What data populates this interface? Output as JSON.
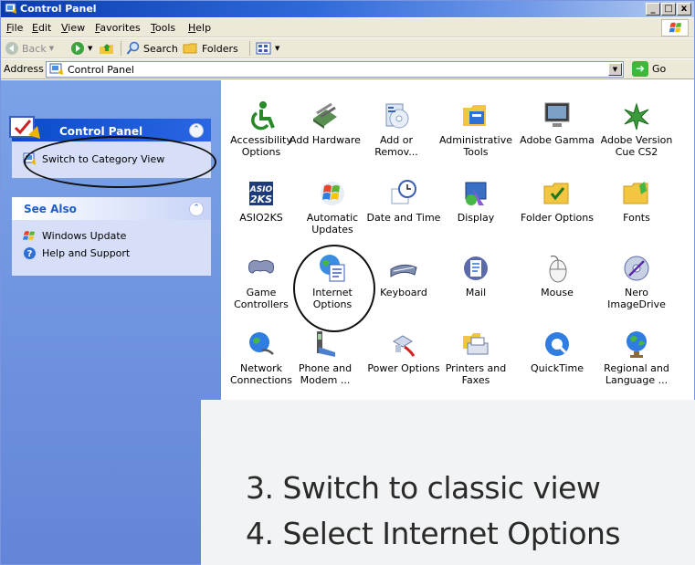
{
  "window": {
    "title": "Control Panel",
    "controls": {
      "minimize": "_",
      "maximize": "□",
      "close": "x"
    }
  },
  "menu": [
    "File",
    "Edit",
    "View",
    "Favorites",
    "Tools",
    "Help"
  ],
  "toolbar": {
    "back": "Back",
    "search": "Search",
    "folders": "Folders"
  },
  "address": {
    "label": "Address",
    "value": "Control Panel",
    "go": "Go"
  },
  "sidebar": {
    "control_panel_box": {
      "title": "Control Panel",
      "link": "Switch to Category View"
    },
    "see_also_box": {
      "title": "See Also",
      "links": [
        "Windows Update",
        "Help and Support"
      ]
    }
  },
  "icons": [
    {
      "label": "Accessibility Options",
      "icon": "accessibility-icon"
    },
    {
      "label": "Add Hardware",
      "icon": "add-hardware-icon"
    },
    {
      "label": "Add or Remov...",
      "icon": "add-remove-programs-icon"
    },
    {
      "label": "Administrative Tools",
      "icon": "administrative-tools-icon"
    },
    {
      "label": "Adobe Gamma",
      "icon": "adobe-gamma-icon"
    },
    {
      "label": "Adobe Version Cue CS2",
      "icon": "adobe-version-cue-icon"
    },
    {
      "label": "ASIO2KS",
      "icon": "asio2ks-icon"
    },
    {
      "label": "Automatic Updates",
      "icon": "automatic-updates-icon"
    },
    {
      "label": "Date and Time",
      "icon": "date-time-icon"
    },
    {
      "label": "Display",
      "icon": "display-icon"
    },
    {
      "label": "Folder Options",
      "icon": "folder-options-icon"
    },
    {
      "label": "Fonts",
      "icon": "fonts-icon"
    },
    {
      "label": "Game Controllers",
      "icon": "game-controllers-icon"
    },
    {
      "label": "Internet Options",
      "icon": "internet-options-icon"
    },
    {
      "label": "Keyboard",
      "icon": "keyboard-icon"
    },
    {
      "label": "Mail",
      "icon": "mail-icon"
    },
    {
      "label": "Mouse",
      "icon": "mouse-icon"
    },
    {
      "label": "Nero ImageDrive",
      "icon": "nero-imagedrive-icon"
    },
    {
      "label": "Network Connections",
      "icon": "network-connections-icon"
    },
    {
      "label": "Phone and Modem ...",
      "icon": "phone-modem-icon"
    },
    {
      "label": "Power Options",
      "icon": "power-options-icon"
    },
    {
      "label": "Printers and Faxes",
      "icon": "printers-faxes-icon"
    },
    {
      "label": "QuickTime",
      "icon": "quicktime-icon"
    },
    {
      "label": "Regional and Language ...",
      "icon": "regional-language-icon"
    }
  ],
  "instructions": [
    "3. Switch to classic view",
    "4. Select Internet Options"
  ],
  "colors": {
    "titlebar": "#0a3db0",
    "task_pane": "#6f94e0",
    "task_link": "#215dc6",
    "annotation_ring": "#111111"
  }
}
